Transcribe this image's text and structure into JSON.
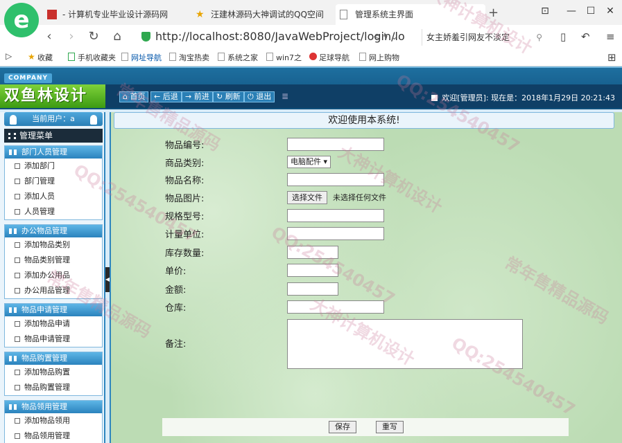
{
  "browser": {
    "logo_glyph": "e",
    "tabs": [
      {
        "label": "- 计算机专业毕业设计源码网"
      },
      {
        "label": "汪建林源码大神调试的QQ空间"
      },
      {
        "label": "管理系统主界面"
      }
    ],
    "new_tab": "+",
    "window_controls": [
      "⊡",
      "—",
      "☐",
      "✕"
    ],
    "url": "http://localhost:8080/JavaWebProject/login/lo",
    "url_tools": "< ϟ ⌄",
    "search_text": "女主娇羞引网友不淡定",
    "search_icon": "⚲",
    "bookmarks": [
      "收藏",
      "手机收藏夹",
      "网址导航",
      "淘宝热卖",
      "系统之家",
      "win7之",
      "足球导航",
      "网上购物"
    ]
  },
  "app": {
    "company": "COMPANY",
    "logo": "双鱼林设计",
    "nav": [
      "首页",
      "后退",
      "前进",
      "刷新",
      "退出"
    ],
    "nav_icons": [
      "⌂",
      "←",
      "→",
      "↻",
      "⏻"
    ],
    "nav_separator": "≣",
    "welcome": "欢迎[管理员]:   现在是：2018年1月29日 20:21:43",
    "current_user": "当前用户：a",
    "menu_title": "管理菜单",
    "groups": [
      {
        "title": "部门人员管理",
        "items": [
          "添加部门",
          "部门管理",
          "添加人员",
          "人员管理"
        ]
      },
      {
        "title": "办公物品管理",
        "items": [
          "添加物品类别",
          "物品类别管理",
          "添加办公用品",
          "办公用品管理"
        ]
      },
      {
        "title": "物品申请管理",
        "items": [
          "添加物品申请",
          "物品申请管理"
        ]
      },
      {
        "title": "物品购置管理",
        "items": [
          "添加物品购置",
          "物品购置管理"
        ]
      },
      {
        "title": "物品领用管理",
        "items": [
          "添加物品领用",
          "物品领用管理"
        ]
      }
    ],
    "content_title": "欢迎使用本系统!",
    "form": {
      "labels": [
        "物品编号:",
        "商品类别:",
        "物品名称:",
        "物品图片:",
        "规格型号:",
        "计量单位:",
        "库存数量:",
        "单价:",
        "金额:",
        "仓库:",
        "备注:"
      ],
      "category_selected": "电脑配件 ▾",
      "file_button": "选择文件",
      "file_status": "未选择任何文件",
      "save": "保存",
      "reset": "重写"
    },
    "collapse_glyph": "◀"
  },
  "watermarks": [
    "大神计算机设计",
    "常年售精品源码",
    "QQ:254540457"
  ]
}
